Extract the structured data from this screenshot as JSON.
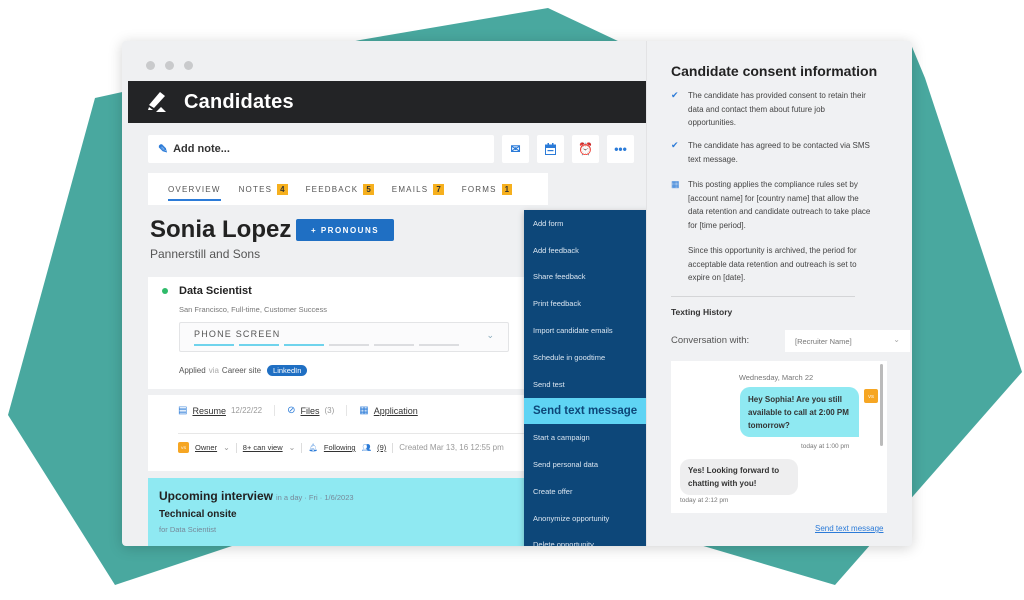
{
  "colors": {
    "background_shape": "#49a89f",
    "header_bg": "#232426",
    "accent_blue": "#1f6fc3",
    "menu_bg": "#0d4779",
    "menu_highlight": "#5fd4f4",
    "interview_bg": "#8fe9f2",
    "badge": "#f6b01e"
  },
  "header": {
    "title": "Candidates",
    "logo_icon": "pen-logo-icon"
  },
  "toolbar": {
    "add_note_placeholder": "Add note...",
    "buttons": [
      {
        "icon": "envelope-icon"
      },
      {
        "icon": "calendar-icon"
      },
      {
        "icon": "alarm-clock-icon"
      },
      {
        "icon": "more-icon",
        "label": "•••"
      }
    ]
  },
  "tabs": [
    {
      "label": "OVERVIEW",
      "active": true
    },
    {
      "label": "NOTES",
      "count": "4"
    },
    {
      "label": "FEEDBACK",
      "count": "5"
    },
    {
      "label": "EMAILS",
      "count": "7"
    },
    {
      "label": "FORMS",
      "count": "1"
    }
  ],
  "candidate": {
    "name": "Sonia Lopez",
    "pronouns_button": "+ PRONOUNS",
    "company": "Pannerstill and Sons"
  },
  "opportunity": {
    "title": "Data Scientist",
    "subtitle": "San Francisco, Full-time, Customer Success",
    "stage": "PHONE SCREEN",
    "stage_progress": {
      "completed": 3,
      "total": 6
    },
    "applied_prefix": "Applied",
    "applied_via": "via",
    "applied_source": "Career site",
    "source_tag": "LinkedIn"
  },
  "files": {
    "resume_label": "Resume",
    "resume_date": "12/22/22",
    "files_label": "Files",
    "files_count": "(3)",
    "application_label": "Application"
  },
  "meta": {
    "owner_label": "Owner",
    "visibility_label": "8+ can view",
    "following_label": "Following",
    "followers_count": "(9)",
    "created": "Created Mar 13, 16 12:55 pm"
  },
  "interview": {
    "title": "Upcoming interview",
    "when": "in a day · Fri · 1/6/2023",
    "type": "Technical onsite",
    "for": "for Data Scientist"
  },
  "menu": {
    "items": [
      {
        "label": "Add form"
      },
      {
        "label": "Add feedback"
      },
      {
        "label": "Share feedback"
      },
      {
        "label": "Print feedback"
      },
      {
        "label": "Import candidate emails"
      },
      {
        "label": "Schedule in goodtime"
      },
      {
        "label": "Send test"
      },
      {
        "label": "Send text message",
        "highlighted": true
      },
      {
        "label": "Start a campaign"
      },
      {
        "label": "Send personal data"
      },
      {
        "label": "Create offer"
      },
      {
        "label": "Anonymize opportunity"
      },
      {
        "label": "Delete opportunity"
      }
    ]
  },
  "consent": {
    "title": "Candidate consent information",
    "items": [
      {
        "icon": "checkmark-icon",
        "text": "The candidate has provided consent to retain their data and contact them about future job opportunities."
      },
      {
        "icon": "checkmark-icon",
        "text": "The candidate has agreed to be contacted via SMS text message."
      },
      {
        "icon": "calendar-icon",
        "text": "This posting applies the compliance rules set by [account name] for [country name] that allow the data retention and candidate outreach to take place for [time period]."
      }
    ],
    "note": "Since this opportunity is archived, the period for acceptable data retention and outreach is set to expire on [date]."
  },
  "texting": {
    "title": "Texting History",
    "conversation_label": "Conversation with:",
    "recruiter_select": "[Recruiter Name]",
    "date": "Wednesday, March 22",
    "messages": [
      {
        "direction": "outgoing",
        "text": "Hey Sophia! Are you still available to call at 2:00 PM tomorrow?",
        "time": "today at 1:00 pm"
      },
      {
        "direction": "incoming",
        "text": "Yes! Looking forward to chatting with you!",
        "time": "today at 2:12 pm"
      }
    ],
    "send_link": "Send text message"
  }
}
